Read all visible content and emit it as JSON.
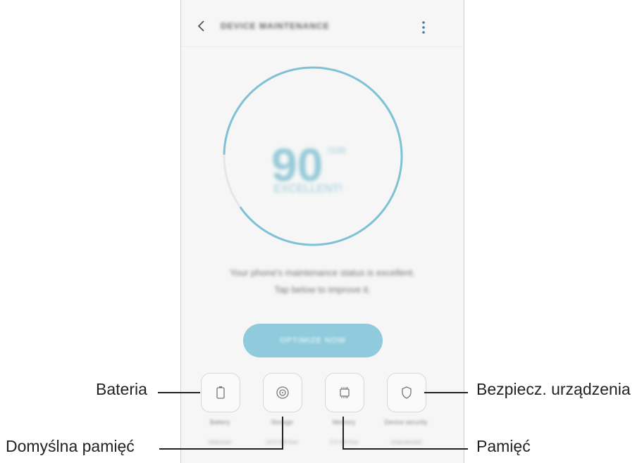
{
  "app_bar": {
    "title": "DEVICE MAINTENANCE",
    "back_icon": "chevron-left-icon",
    "menu_icon": "more-vertical-icon"
  },
  "score": {
    "value": "90",
    "unit": "/100",
    "status": "EXCELLENT!",
    "ring_color": "#7fc2d6",
    "ring_fill_fraction": 0.9
  },
  "message": {
    "line1": "Your phone's maintenance status is excellent.",
    "line2": "Tap below to improve it."
  },
  "optimize_button": {
    "label": "OPTIMIZE NOW",
    "color": "#8fcbdc"
  },
  "tiles": [
    {
      "name": "Battery",
      "value": "Unknown",
      "icon": "battery-icon"
    },
    {
      "name": "Storage",
      "value": "14.5 GB free",
      "icon": "storage-icon"
    },
    {
      "name": "Memory",
      "value": "2.5 GB free",
      "icon": "memory-chip-icon"
    },
    {
      "name": "Device security",
      "value": "Unprotected",
      "icon": "shield-icon"
    }
  ],
  "callouts": {
    "battery": "Bateria",
    "storage": "Domyślna pamięć",
    "security": "Bezpiecz. urządzenia",
    "memory": "Pamięć"
  }
}
